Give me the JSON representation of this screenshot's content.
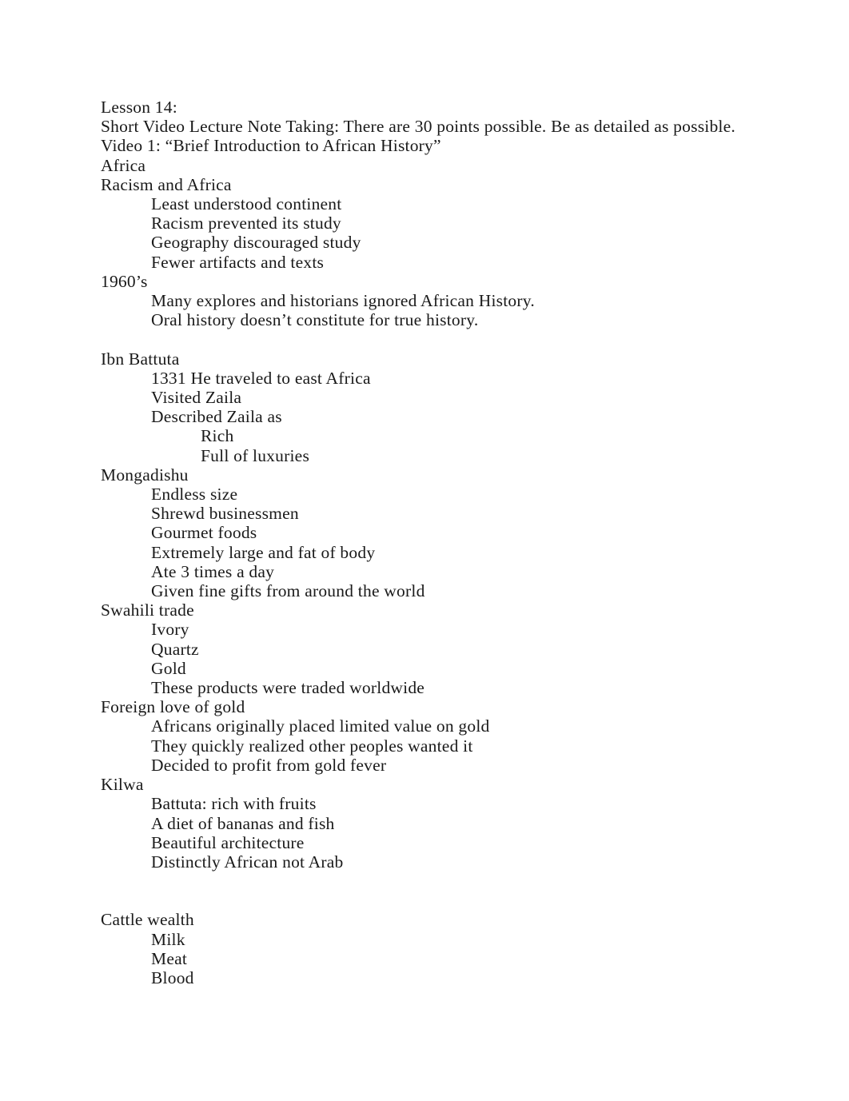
{
  "document": {
    "title": "Lesson 14:",
    "page_background": "#ffffff",
    "text_color": "#1a1a1a",
    "lines": [
      {
        "level": 0,
        "text": "Lesson 14:"
      },
      {
        "level": 0,
        "text": "Short Video Lecture Note Taking: There are 30 points possible. Be as detailed as possible."
      },
      {
        "level": 0,
        "text": "Video 1: “Brief Introduction to African History”"
      },
      {
        "level": 0,
        "text": "Africa"
      },
      {
        "level": 0,
        "text": "Racism and Africa"
      },
      {
        "level": 1,
        "text": "Least understood continent"
      },
      {
        "level": 1,
        "text": "Racism prevented its study"
      },
      {
        "level": 1,
        "text": "Geography discouraged study"
      },
      {
        "level": 1,
        "text": "Fewer artifacts and texts"
      },
      {
        "level": 0,
        "text": "1960’s"
      },
      {
        "level": 1,
        "text": "Many explores and historians ignored African History."
      },
      {
        "level": 1,
        "text": "Oral history doesn’t constitute for true history."
      },
      {
        "level": 0,
        "text": ""
      },
      {
        "level": 0,
        "text": "Ibn Battuta"
      },
      {
        "level": 1,
        "text": "1331 He traveled to east Africa"
      },
      {
        "level": 1,
        "text": "Visited Zaila"
      },
      {
        "level": 1,
        "text": "Described Zaila as"
      },
      {
        "level": 2,
        "text": "Rich"
      },
      {
        "level": 2,
        "text": "Full of luxuries"
      },
      {
        "level": 0,
        "text": "Mongadishu"
      },
      {
        "level": 1,
        "text": "Endless size"
      },
      {
        "level": 1,
        "text": "Shrewd businessmen"
      },
      {
        "level": 1,
        "text": "Gourmet foods"
      },
      {
        "level": 1,
        "text": "Extremely large and fat of body"
      },
      {
        "level": 1,
        "text": "Ate 3 times a day"
      },
      {
        "level": 1,
        "text": "Given fine gifts from around the world"
      },
      {
        "level": 0,
        "text": "Swahili trade"
      },
      {
        "level": 1,
        "text": "Ivory"
      },
      {
        "level": 1,
        "text": "Quartz"
      },
      {
        "level": 1,
        "text": "Gold"
      },
      {
        "level": 1,
        "text": "These products were traded worldwide"
      },
      {
        "level": 0,
        "text": "Foreign love of gold"
      },
      {
        "level": 1,
        "text": "Africans originally placed limited value on gold"
      },
      {
        "level": 1,
        "text": "They quickly realized other peoples wanted it"
      },
      {
        "level": 1,
        "text": "Decided to profit from gold fever"
      },
      {
        "level": 0,
        "text": "Kilwa"
      },
      {
        "level": 1,
        "text": "Battuta: rich with fruits"
      },
      {
        "level": 1,
        "text": "A diet of bananas and fish"
      },
      {
        "level": 1,
        "text": "Beautiful architecture"
      },
      {
        "level": 1,
        "text": "Distinctly African not Arab"
      },
      {
        "level": 0,
        "text": ""
      },
      {
        "level": 0,
        "text": ""
      },
      {
        "level": 0,
        "text": "Cattle wealth"
      },
      {
        "level": 1,
        "text": "Milk"
      },
      {
        "level": 1,
        "text": "Meat"
      },
      {
        "level": 1,
        "text": "Blood"
      }
    ]
  }
}
